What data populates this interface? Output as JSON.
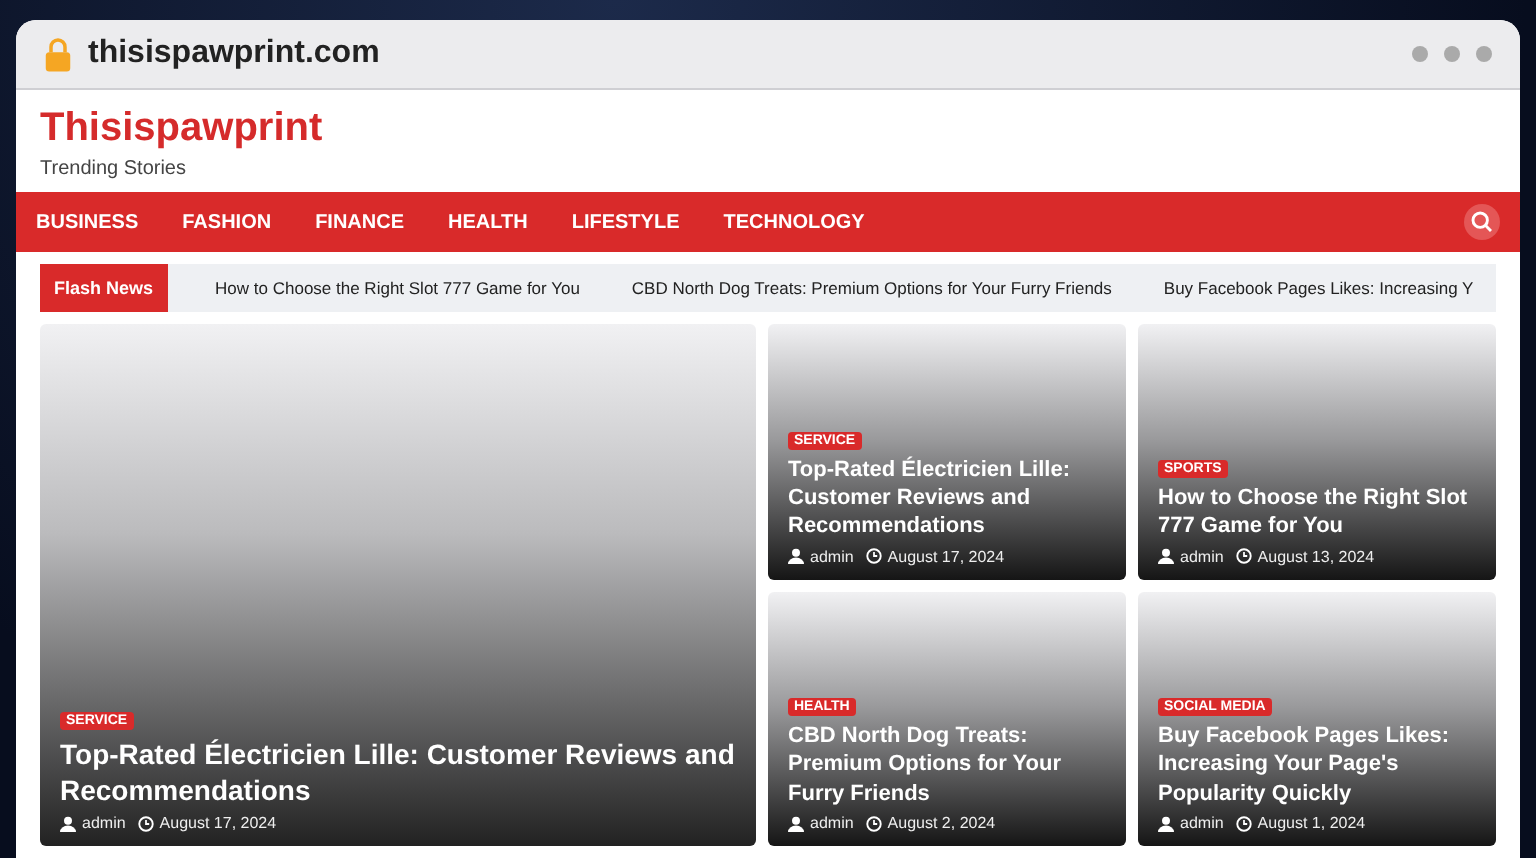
{
  "browser": {
    "address": "thisispawprint.com"
  },
  "site": {
    "title": "Thisispawprint",
    "tagline": "Trending Stories"
  },
  "nav": {
    "items": [
      "BUSINESS",
      "FASHION",
      "FINANCE",
      "HEALTH",
      "LIFESTYLE",
      "TECHNOLOGY"
    ]
  },
  "flash_news": {
    "label": "Flash News",
    "items": [
      "How to Choose the Right Slot 777 Game for You",
      "CBD North Dog Treats: Premium Options for Your Furry Friends",
      "Buy Facebook Pages Likes: Increasing Y"
    ]
  },
  "posts": [
    {
      "kind": "featured",
      "category": "SERVICE",
      "title": "Top-Rated Électricien Lille: Customer Reviews and Recommendations",
      "author": "admin",
      "date": "August 17, 2024"
    },
    {
      "kind": "card",
      "category": "SERVICE",
      "title": "Top-Rated Électricien Lille: Customer Reviews and Recommendations",
      "author": "admin",
      "date": "August 17, 2024"
    },
    {
      "kind": "card",
      "category": "SPORTS",
      "title": "How to Choose the Right Slot 777 Game for You",
      "author": "admin",
      "date": "August 13, 2024"
    },
    {
      "kind": "card",
      "category": "HEALTH",
      "title": "CBD North Dog Treats: Premium Options for Your Furry Friends",
      "author": "admin",
      "date": "August 2, 2024"
    },
    {
      "kind": "card",
      "category": "SOCIAL MEDIA",
      "title": "Buy Facebook Pages Likes: Increasing Your Page's Popularity Quickly",
      "author": "admin",
      "date": "August 1, 2024"
    }
  ]
}
